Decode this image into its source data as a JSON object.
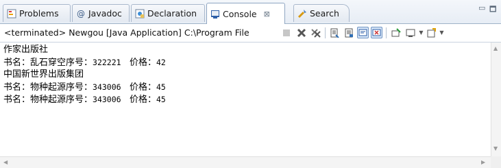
{
  "tabs": [
    {
      "label": "Problems",
      "icon": "problems-icon"
    },
    {
      "label": "Javadoc",
      "icon": "at-icon"
    },
    {
      "label": "Declaration",
      "icon": "declaration-icon"
    },
    {
      "label": "Console",
      "icon": "console-icon",
      "close": "⊠"
    },
    {
      "label": "Search",
      "icon": "search-icon"
    }
  ],
  "window_controls": {
    "minimize": "▭",
    "maximize": "🗖"
  },
  "toolbar": {
    "status": "<terminated> Newgou [Java Application] C:\\Program File"
  },
  "console": {
    "lines": [
      {
        "text": "作家出版社"
      },
      {
        "label": "书名：乱石穿空序号：",
        "serial": "322221",
        "price_label": "价格：",
        "price": "42"
      },
      {
        "text": "中国新世界出版集团"
      },
      {
        "label": "书名：物种起源序号：",
        "serial": "343006",
        "price_label": "价格：",
        "price": "45"
      },
      {
        "label": "书名：物种起源序号：",
        "serial": "343006",
        "price_label": "价格：",
        "price": "45"
      }
    ]
  },
  "colors": {
    "accent": "#8fa6c2",
    "background": "#ffffff"
  }
}
